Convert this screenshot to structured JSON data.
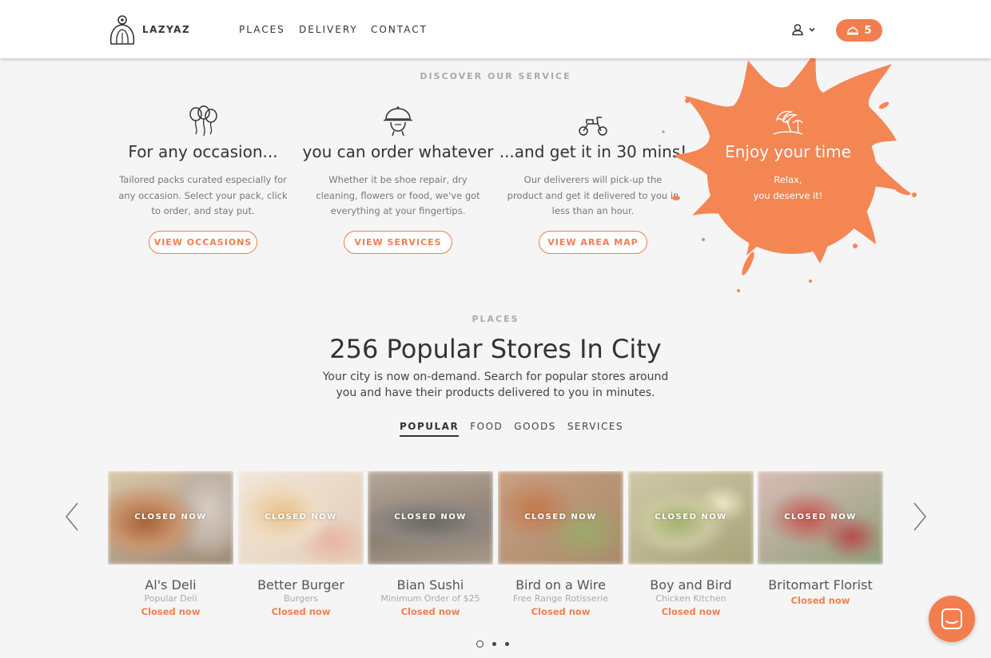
{
  "header": {
    "brand": "LAZYAZ",
    "nav": [
      "PLACES",
      "DELIVERY",
      "CONTACT"
    ],
    "cart_count": "5"
  },
  "service": {
    "kicker": "DISCOVER OUR SERVICE",
    "items": [
      {
        "icon": "balloons-icon",
        "title": "For any occasion...",
        "text": "Tailored packs curated especially for any occasion. Select your pack, click to order, and stay put.",
        "button": "VIEW OCCASIONS"
      },
      {
        "icon": "cloche-icon",
        "title": "you can order whatever",
        "text": "Whether it be shoe repair, dry cleaning, flowers or food, we've got everything at your fingertips.",
        "button": "VIEW SERVICES"
      },
      {
        "icon": "scooter-icon",
        "title": "...and get it in 30 mins!",
        "text": "Our deliverers will pick-up the product and get it delivered to you in less than an hour.",
        "button": "VIEW AREA MAP"
      }
    ],
    "promo": {
      "icon": "beach-icon",
      "title": "Enjoy your time",
      "line1": "Relax,",
      "line2": "you deserve it!"
    }
  },
  "places": {
    "kicker": "PLACES",
    "title": "256 Popular Stores In City",
    "lead": "Your city is now on-demand. Search for popular stores around you and have their products delivered to you in minutes.",
    "tabs": [
      "POPULAR",
      "FOOD",
      "GOODS",
      "SERVICES"
    ],
    "active_tab": "POPULAR",
    "stores": [
      {
        "name": "Al's Deli",
        "sub": "Popular Deli",
        "badge": "CLOSED NOW",
        "status": "Closed now"
      },
      {
        "name": "Better Burger",
        "sub": "Burgers",
        "badge": "CLOSED NOW",
        "status": "Closed now"
      },
      {
        "name": "Bian Sushi",
        "sub": "Minimum Order of $25",
        "badge": "CLOSED NOW",
        "status": "Closed now"
      },
      {
        "name": "Bird on a Wire",
        "sub": "Free Range Rotisserie",
        "badge": "CLOSED NOW",
        "status": "Closed now"
      },
      {
        "name": "Boy and Bird",
        "sub": "Chicken Kitchen",
        "badge": "CLOSED NOW",
        "status": "Closed now"
      },
      {
        "name": "Britomart Florist",
        "sub": "",
        "badge": "CLOSED NOW",
        "status": "Closed now"
      }
    ],
    "pagination": {
      "pages": 3,
      "current": 1
    }
  },
  "colors": {
    "accent": "#f27e4f",
    "background": "#f5f5f5",
    "header_bg": "#ffffff"
  }
}
